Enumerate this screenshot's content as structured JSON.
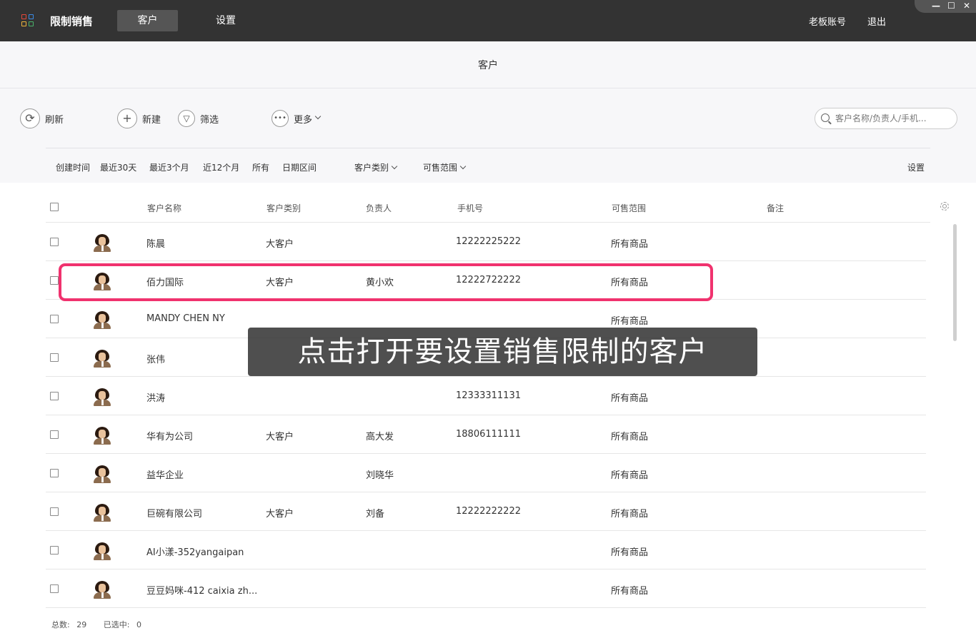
{
  "topbar": {
    "app_name": "限制销售",
    "tabs": [
      {
        "label": "客户",
        "active": true
      },
      {
        "label": "设置",
        "active": false
      }
    ],
    "account_label": "老板账号",
    "logout_label": "退出",
    "window_controls": {
      "minimize": "—",
      "maximize": "☐",
      "close": "✕"
    }
  },
  "page": {
    "title": "客户"
  },
  "toolbar": {
    "refresh_label": "刷新",
    "new_label": "新建",
    "filter_label": "筛选",
    "more_label": "更多",
    "search_placeholder": "客户名称/负责人/手机..."
  },
  "filters": {
    "created_time_label": "创建时间",
    "ranges": [
      "最近30天",
      "最近3个月",
      "近12个月",
      "所有",
      "日期区间"
    ],
    "customer_type_label": "客户类别",
    "sale_scope_label": "可售范围",
    "settings_label": "设置"
  },
  "table": {
    "columns": {
      "name": "客户名称",
      "type": "客户类别",
      "owner": "负责人",
      "phone": "手机号",
      "scope": "可售范围",
      "note": "备注"
    },
    "rows": [
      {
        "name": "陈晨",
        "type": "大客户",
        "owner": "",
        "phone": "12222225222",
        "scope": "所有商品",
        "note": ""
      },
      {
        "name": "佰力国际",
        "type": "大客户",
        "owner": "黄小欢",
        "phone": "12222722222",
        "scope": "所有商品",
        "note": ""
      },
      {
        "name": "MANDY CHEN NY",
        "type": "",
        "owner": "",
        "phone": "",
        "scope": "所有商品",
        "note": ""
      },
      {
        "name": "张伟",
        "type": "",
        "owner": "",
        "phone": "",
        "scope": "",
        "note": ""
      },
      {
        "name": "洪涛",
        "type": "",
        "owner": "",
        "phone": "12333311131",
        "scope": "所有商品",
        "note": ""
      },
      {
        "name": "华有为公司",
        "type": "大客户",
        "owner": "高大发",
        "phone": "18806111111",
        "scope": "所有商品",
        "note": ""
      },
      {
        "name": "益华企业",
        "type": "",
        "owner": "刘晓华",
        "phone": "",
        "scope": "所有商品",
        "note": ""
      },
      {
        "name": "巨碗有限公司",
        "type": "大客户",
        "owner": "刘备",
        "phone": "12222222222",
        "scope": "所有商品",
        "note": ""
      },
      {
        "name": "AI小漾-352yangaipan",
        "type": "",
        "owner": "",
        "phone": "",
        "scope": "所有商品",
        "note": ""
      },
      {
        "name": "豆豆妈咪-412 caixia zh...",
        "type": "",
        "owner": "",
        "phone": "",
        "scope": "所有商品",
        "note": ""
      }
    ]
  },
  "overlay": {
    "caption": "点击打开要设置销售限制的客户",
    "highlight_color": "#f0326e"
  },
  "footer": {
    "total_label": "总数:",
    "total_value": "29",
    "selected_label": "已选中:",
    "selected_value": "0"
  },
  "colors": {
    "topbar_bg": "#333333",
    "active_tab_bg": "#555555",
    "header_bg": "#f7f7f9"
  }
}
